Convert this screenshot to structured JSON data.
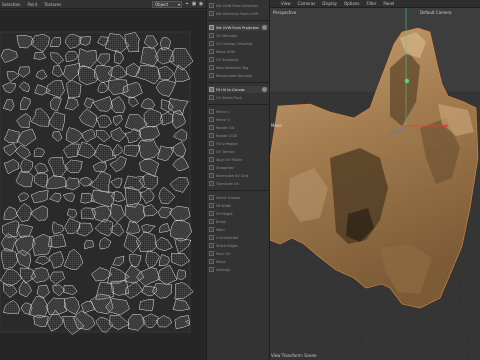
{
  "uv_editor": {
    "menus": [
      "Selection",
      "Point",
      "Textures"
    ],
    "dropdown_value": "Object",
    "tools": [
      "pin-icon",
      "lock-icon",
      "link-icon",
      "view-icon"
    ]
  },
  "tool_panel": {
    "items": [
      {
        "label": "Set UVW From Selection"
      },
      {
        "label": "Set Selection From UVW"
      },
      {
        "label": "Set UVW From Projection",
        "active": true
      },
      {
        "label": "UV Manager"
      },
      {
        "label": "UV Unwrap / Packing"
      },
      {
        "label": "Relax UVW"
      },
      {
        "label": "UV Snapping"
      },
      {
        "label": "New Selection Tag"
      },
      {
        "label": "Recalculate Normals"
      },
      {
        "label": "Fit UV to Canvas",
        "active": true
      },
      {
        "label": "UV Select Pack"
      },
      {
        "label": "Mirror U"
      },
      {
        "label": "Mirror V"
      },
      {
        "label": "Rotate CW"
      },
      {
        "label": "Rotate CCW"
      },
      {
        "label": "Fit to Region"
      },
      {
        "label": "UV Terrace"
      },
      {
        "label": "Align UV Points"
      },
      {
        "label": "Straighten"
      },
      {
        "label": "Normalize UV Grid"
      },
      {
        "label": "Transform UV"
      },
      {
        "label": "Select Islands"
      },
      {
        "label": "Fit Width"
      },
      {
        "label": "Fit Height"
      },
      {
        "label": "Break"
      },
      {
        "label": "Weld"
      },
      {
        "label": "Cut Selected"
      },
      {
        "label": "Stitch Edges"
      },
      {
        "label": "Pack UV"
      },
      {
        "label": "Relax"
      },
      {
        "label": "Settings"
      }
    ]
  },
  "viewport": {
    "menus": [
      "View",
      "Cameras",
      "Display",
      "Options",
      "Filter",
      "Panel"
    ],
    "projection": "Perspective",
    "camera": "Default Camera",
    "tool_hint": "Move",
    "footer": "View Transform: Scene",
    "colors": {
      "mesh_fill": "#a9865a",
      "mesh_wire": "#e58a3c",
      "background": "#3b3b3b",
      "grid_line": "#2e2e2e"
    }
  }
}
